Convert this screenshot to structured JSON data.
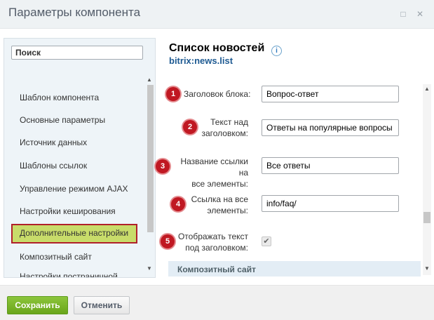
{
  "window": {
    "title": "Параметры компонента",
    "controls": [
      "minimize-icon",
      "close-icon"
    ]
  },
  "sidebar": {
    "search_placeholder": "Поиск",
    "items": [
      {
        "label": "Шаблон компонента"
      },
      {
        "label": "Основные параметры"
      },
      {
        "label": "Источник данных"
      },
      {
        "label": "Шаблоны ссылок"
      },
      {
        "label": "Управление режимом AJAX"
      },
      {
        "label": "Настройки кеширования"
      },
      {
        "label": "Дополнительные настройки",
        "active": true
      },
      {
        "label": "Композитный сайт"
      },
      {
        "label": "Настройки постраничной"
      }
    ]
  },
  "component": {
    "title": "Список новостей",
    "code": "bitrix:news.list"
  },
  "params": [
    {
      "badge": "1",
      "label_line1": "Заголовок блока:",
      "label_line2": "",
      "value": "Вопрос-ответ",
      "type": "text"
    },
    {
      "badge": "2",
      "label_line1": "Текст над",
      "label_line2": "заголовком:",
      "value": "Ответы на популярные вопросы",
      "type": "text"
    },
    {
      "badge": "3",
      "label_line1": "Название ссылки на",
      "label_line2": "все элементы:",
      "value": "Все ответы",
      "type": "text"
    },
    {
      "badge": "4",
      "label_line1": "Ссылка на все",
      "label_line2": "элементы:",
      "value": "info/faq/",
      "type": "text"
    },
    {
      "badge": "5",
      "label_line1": "Отображать текст",
      "label_line2": "под заголовком:",
      "value": "checked",
      "type": "checkbox"
    }
  ],
  "section": {
    "title": "Композитный сайт"
  },
  "footer": {
    "save_label": "Сохранить",
    "cancel_label": "Отменить"
  },
  "colors": {
    "badge": "#c01822",
    "active_item_bg": "#c8dc6a",
    "active_item_border": "#b0202a",
    "save_button": "#7ab52a",
    "component_code": "#1e5a92"
  }
}
